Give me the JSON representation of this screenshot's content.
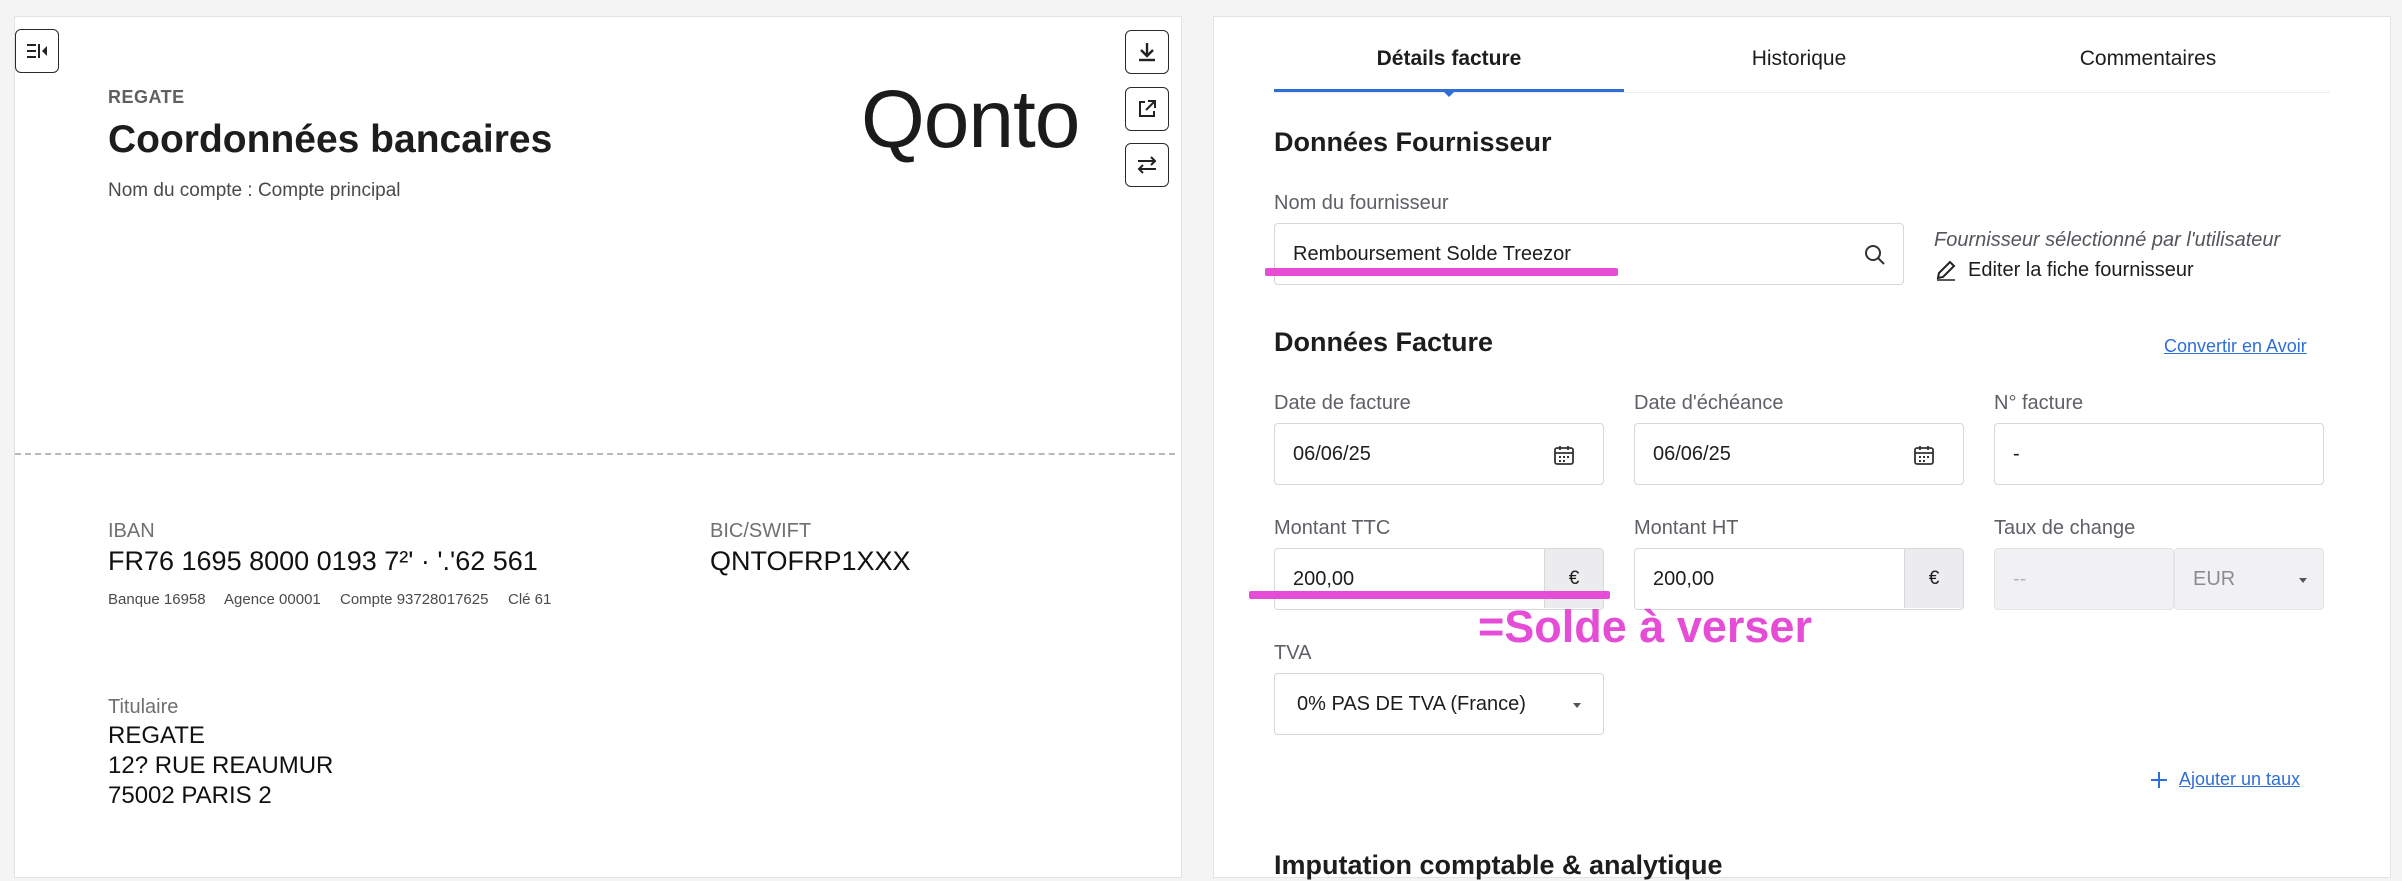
{
  "bank_document": {
    "company_name": "REGATE",
    "title": "Coordonnées bancaires",
    "account_line": "Nom du compte : Compte principal",
    "logo_text": "Qonto",
    "iban_label": "IBAN",
    "iban_value": "FR76 1695 8000 0193 7²' · '.'62 561",
    "bank_code": "Banque 16958",
    "agency_code": "Agence 00001",
    "account_number": "Compte 93728017625",
    "rib_key": "Clé 61",
    "bic_label": "BIC/SWIFT",
    "bic_value": "QNTOFRP1XXX",
    "holder_label": "Titulaire",
    "holder_name": "REGATE",
    "holder_address_1": "12? RUE REAUMUR",
    "holder_address_2": "75002 PARIS 2"
  },
  "viewer_toolbar": {
    "collapse_icon": "collapse-panel-icon",
    "download_icon": "download-icon",
    "open_icon": "external-link-icon",
    "swap_icon": "swap-icon"
  },
  "tabs": [
    {
      "label": "Détails facture",
      "active": true
    },
    {
      "label": "Historique",
      "active": false
    },
    {
      "label": "Commentaires",
      "active": false
    }
  ],
  "supplier": {
    "section_title": "Données Fournisseur",
    "field_label": "Nom du fournisseur",
    "field_value": "Remboursement Solde Treezor",
    "helper_text": "Fournisseur sélectionné par l'utilisateur",
    "edit_label": "Editer la fiche fournisseur"
  },
  "invoice": {
    "section_title": "Données Facture",
    "convert_link": "Convertir en Avoir",
    "invoice_date_label": "Date de facture",
    "invoice_date": "06/06/25",
    "due_date_label": "Date d'échéance",
    "due_date": "06/06/25",
    "number_label": "N° facture",
    "number_value": "-",
    "amount_ttc_label": "Montant TTC",
    "amount_ttc": "200,00",
    "amount_ht_label": "Montant HT",
    "amount_ht": "200,00",
    "currency_symbol": "€",
    "exchange_label": "Taux de change",
    "exchange_placeholder": "--",
    "exchange_currency": "EUR",
    "vat_label": "TVA",
    "vat_value": "0% PAS DE TVA (France)",
    "add_rate_label": "Ajouter un taux"
  },
  "accounting": {
    "section_title": "Imputation comptable & analytique"
  },
  "annotation": {
    "text": "=Solde à verser",
    "color": "#e64dd6"
  }
}
